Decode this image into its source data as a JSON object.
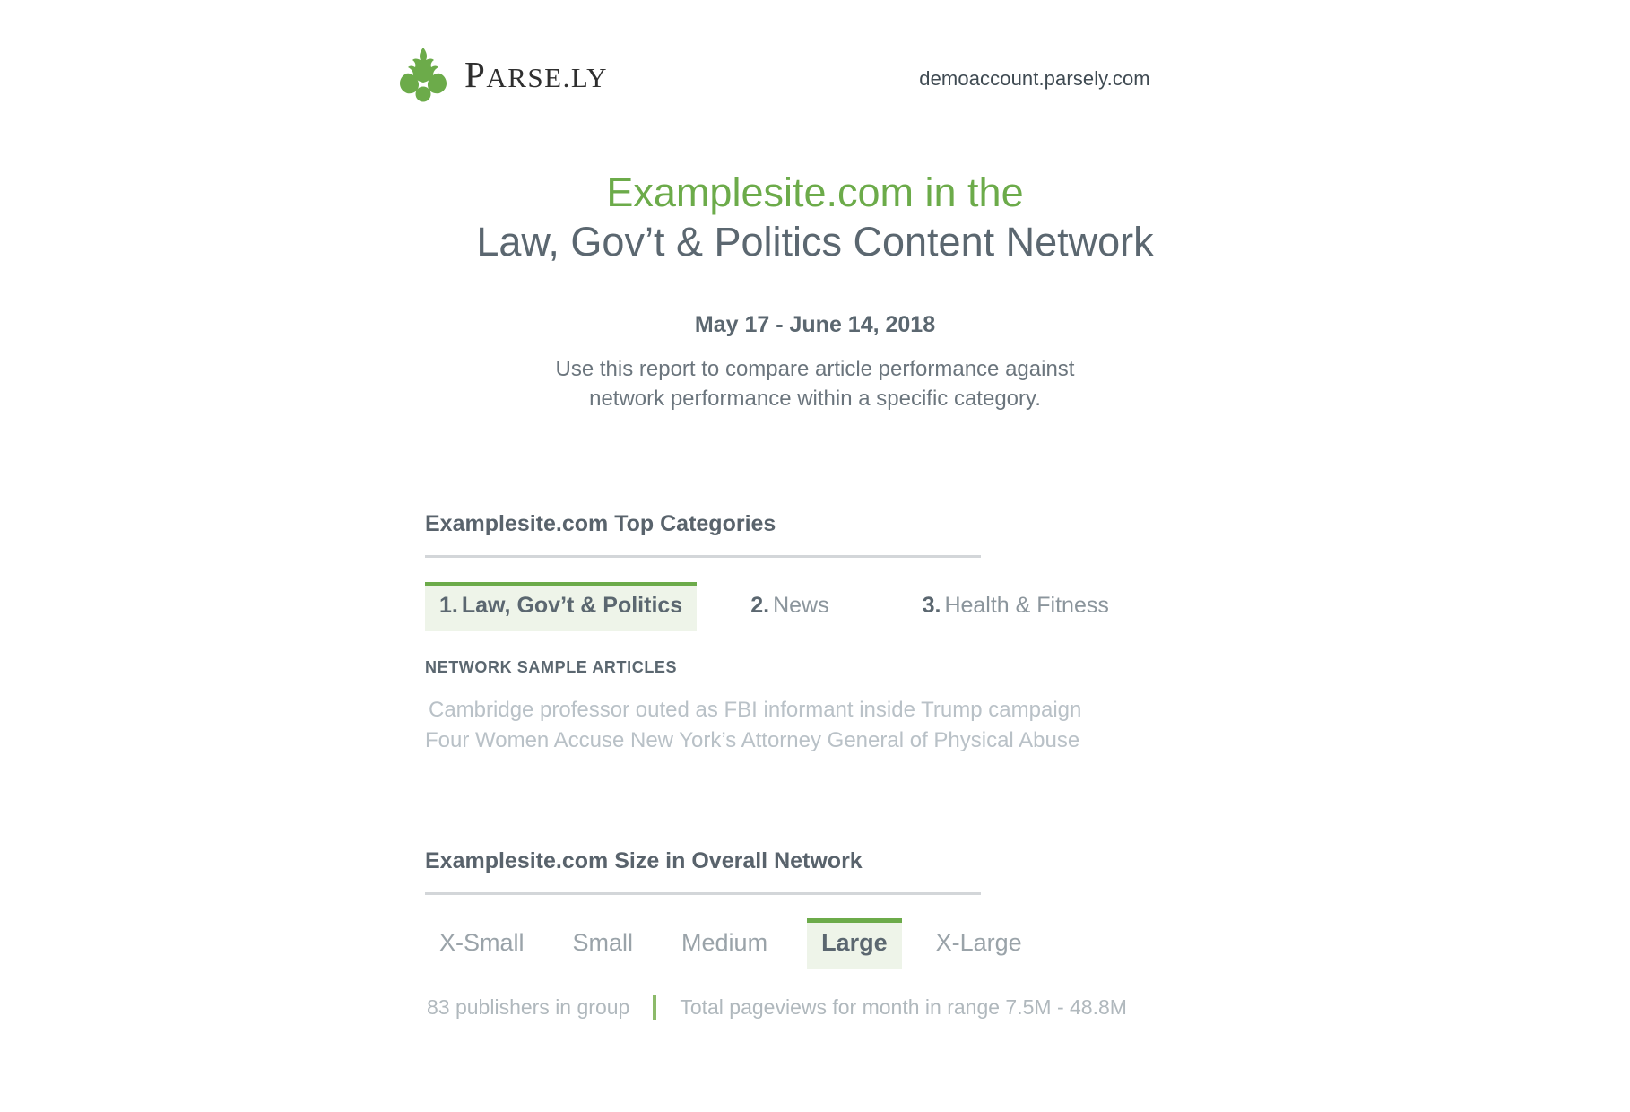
{
  "header": {
    "logo_icon": "parsley-leaf-icon",
    "brand_name": "Parse.ly",
    "brand_main": "P",
    "brand_rest": "ARSE",
    "brand_dot": ".",
    "brand_suffix": "LY",
    "account_url": "demoaccount.parsely.com"
  },
  "title": {
    "line_1": "Examplesite.com in the",
    "line_2": "Law, Gov’t & Politics Content Network",
    "date_range": "May 17 - June 14, 2018",
    "description_line_1": "Use this report to compare article performance against",
    "description_line_2": "network performance within a specific category."
  },
  "categories_section": {
    "title": "Examplesite.com Top Categories",
    "tabs": [
      {
        "rank": "1.",
        "label": "Law, Gov’t & Politics",
        "active": true
      },
      {
        "rank": "2.",
        "label": "News",
        "active": false
      },
      {
        "rank": "3.",
        "label": "Health & Fitness",
        "active": false
      }
    ],
    "sample_label": "NETWORK SAMPLE ARTICLES",
    "sample_articles": [
      "Cambridge professor outed as FBI informant inside Trump campaign",
      "Four Women Accuse New York’s Attorney General of Physical Abuse"
    ]
  },
  "size_section": {
    "title": "Examplesite.com Size in Overall Network",
    "tiers": [
      {
        "label": "X-Small",
        "active": false
      },
      {
        "label": "Small",
        "active": false
      },
      {
        "label": "Medium",
        "active": false
      },
      {
        "label": "Large",
        "active": true
      },
      {
        "label": "X-Large",
        "active": false
      }
    ],
    "publishers_text": "83 publishers in group",
    "pageviews_text": "Total pageviews for month in range 7.5M - 48.8M"
  },
  "colors": {
    "accent_green": "#6cab4a",
    "active_tab_bg": "#eef4e9",
    "body_text": "#5b6770",
    "muted_text": "#b9c1c7",
    "rule": "#d3d6d9"
  }
}
